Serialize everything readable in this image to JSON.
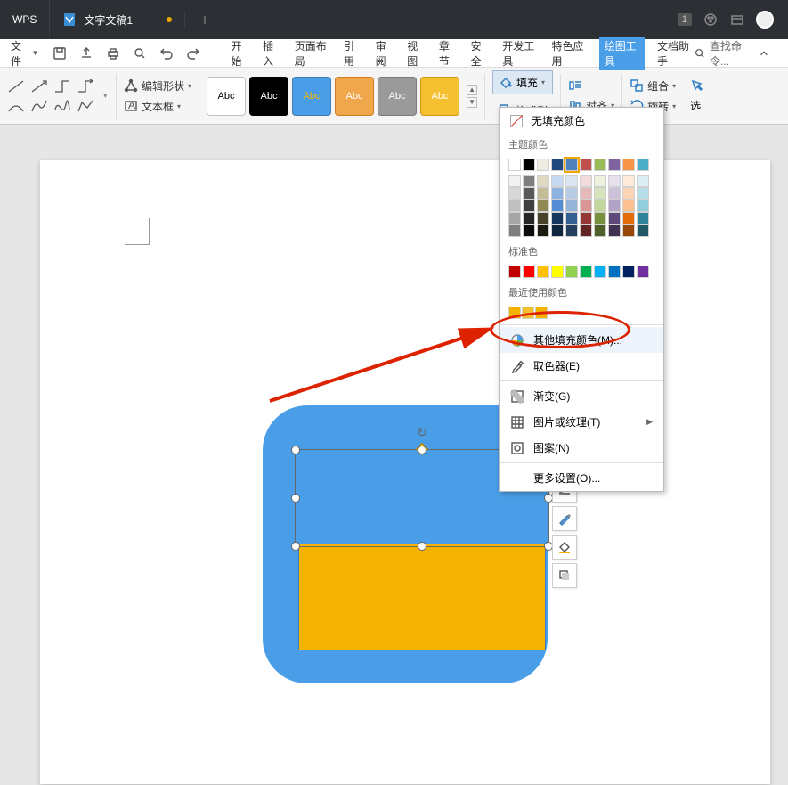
{
  "title_bar": {
    "wps_label": "WPS",
    "doc_title": "文字文稿1",
    "new_tab_glyph": "＋",
    "badge": "1"
  },
  "menu_bar": {
    "file": "文件",
    "items": [
      "开始",
      "插入",
      "页面布局",
      "引用",
      "审阅",
      "视图",
      "章节",
      "安全",
      "开发工具",
      "特色应用",
      "绘图工具",
      "文档助手"
    ],
    "active_index": 10,
    "search_placeholder": "查找命令..."
  },
  "ribbon": {
    "edit_shape": "编辑形状",
    "text_box": "文本框",
    "style_label": "Abc",
    "styles": [
      {
        "bg": "#ffffff",
        "fg": "#000000",
        "border": "#bfbfbf"
      },
      {
        "bg": "#000000",
        "fg": "#ffffff",
        "border": "#000000"
      },
      {
        "bg": "#4a9ee8",
        "fg": "#f5b301",
        "border": "#3a7db5"
      },
      {
        "bg": "#f0a64b",
        "fg": "#ffffff",
        "border": "#d07c20"
      },
      {
        "bg": "#9a9a9a",
        "fg": "#ffffff",
        "border": "#7a7a7a"
      },
      {
        "bg": "#f5c030",
        "fg": "#ffffff",
        "border": "#d09a10"
      }
    ],
    "fill_label": "填充",
    "format_painter": "格式刷",
    "align": "对齐",
    "group": "组合",
    "rotate": "旋转",
    "select_suffix": "选"
  },
  "dropdown": {
    "no_fill": "无填充颜色",
    "theme_label": "主题颜色",
    "theme_row1": [
      "#ffffff",
      "#000000",
      "#eeece1",
      "#1f497d",
      "#4f81bd",
      "#c0504d",
      "#9bbb59",
      "#8064a2",
      "#f79646",
      "#4bacc6"
    ],
    "theme_shades": [
      [
        "#f2f2f2",
        "#7f7f7f",
        "#ddd9c3",
        "#c6d9f0",
        "#dbe5f1",
        "#f2dcdb",
        "#ebf1dd",
        "#e5e0ec",
        "#fdeada",
        "#dbeef3"
      ],
      [
        "#d8d8d8",
        "#595959",
        "#c4bd97",
        "#8db3e2",
        "#b8cce4",
        "#e5b9b7",
        "#d7e3bc",
        "#ccc1d9",
        "#fbd5b5",
        "#b7dde8"
      ],
      [
        "#bfbfbf",
        "#3f3f3f",
        "#938953",
        "#548dd4",
        "#95b3d7",
        "#d99694",
        "#c3d69b",
        "#b2a2c7",
        "#fac08f",
        "#92cddc"
      ],
      [
        "#a5a5a5",
        "#262626",
        "#494429",
        "#17365d",
        "#366092",
        "#953734",
        "#76923c",
        "#5f497a",
        "#e36c09",
        "#31859b"
      ],
      [
        "#7f7f7f",
        "#0c0c0c",
        "#1d1b10",
        "#0f243e",
        "#244061",
        "#632423",
        "#4f6128",
        "#3f3151",
        "#974806",
        "#205867"
      ]
    ],
    "standard_label": "标准色",
    "standard_colors": [
      "#c00000",
      "#ff0000",
      "#ffc000",
      "#ffff00",
      "#92d050",
      "#00b050",
      "#00b0f0",
      "#0070c0",
      "#002060",
      "#7030a0"
    ],
    "recent_label": "最近使用颜色",
    "recent_colors": [
      "#f5b301",
      "#f5c030",
      "#f5b301"
    ],
    "more_colors": "其他填充颜色(M)...",
    "eyedropper": "取色器(E)",
    "gradient": "渐变(G)",
    "picture_texture": "图片或纹理(T)",
    "pattern": "图案(N)",
    "more_settings": "更多设置(O)..."
  },
  "float_toolbar": {
    "items": [
      "layout-icon",
      "outline-icon",
      "fill-icon",
      "shadow-icon"
    ]
  }
}
